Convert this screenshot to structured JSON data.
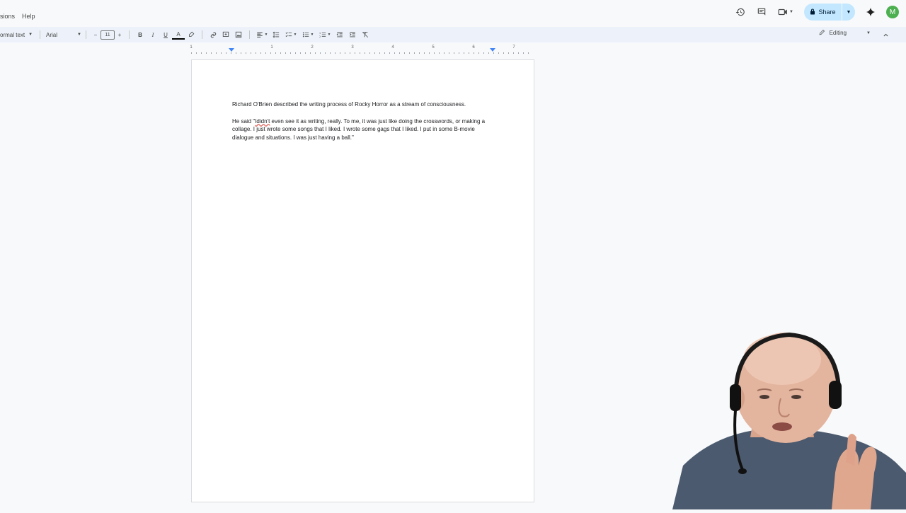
{
  "menubar": {
    "items": [
      "sions",
      "Help"
    ]
  },
  "header": {
    "share_label": "Share",
    "avatar_letter": "M",
    "icons": [
      "history-icon",
      "comment-icon",
      "video-call-icon",
      "lock-icon",
      "gemini-icon"
    ]
  },
  "toolbar": {
    "style_label": "ormal text",
    "font_label": "Arial",
    "font_size": "11",
    "minus_label": "−",
    "plus_label": "+",
    "bold_label": "B",
    "italic_label": "I",
    "underline_label": "U",
    "text_color_label": "A",
    "editing_label": "Editing"
  },
  "ruler": {
    "labels": [
      "1",
      "1",
      "2",
      "3",
      "4",
      "5",
      "6",
      "7"
    ]
  },
  "document": {
    "paragraph1": "Richard O'Brien described the writing process of Rocky Horror as a stream of consciousness.",
    "paragraph2_prefix": "He said \"",
    "paragraph2_misspelled": "Ididn't",
    "paragraph2_rest": " even see it as writing, really. To me, it was just like doing the crosswords, or making a collage. I just wrote some songs that I liked. I wrote some gags that I liked. I put in some B-movie dialogue and situations. I was just having a ball.\""
  },
  "colors": {
    "toolbar_bg": "#edf2fa",
    "share_bg": "#c2e7ff",
    "avatar_bg": "#4caf50",
    "page_bg": "#ffffff",
    "spell_underline": "#d93025"
  }
}
